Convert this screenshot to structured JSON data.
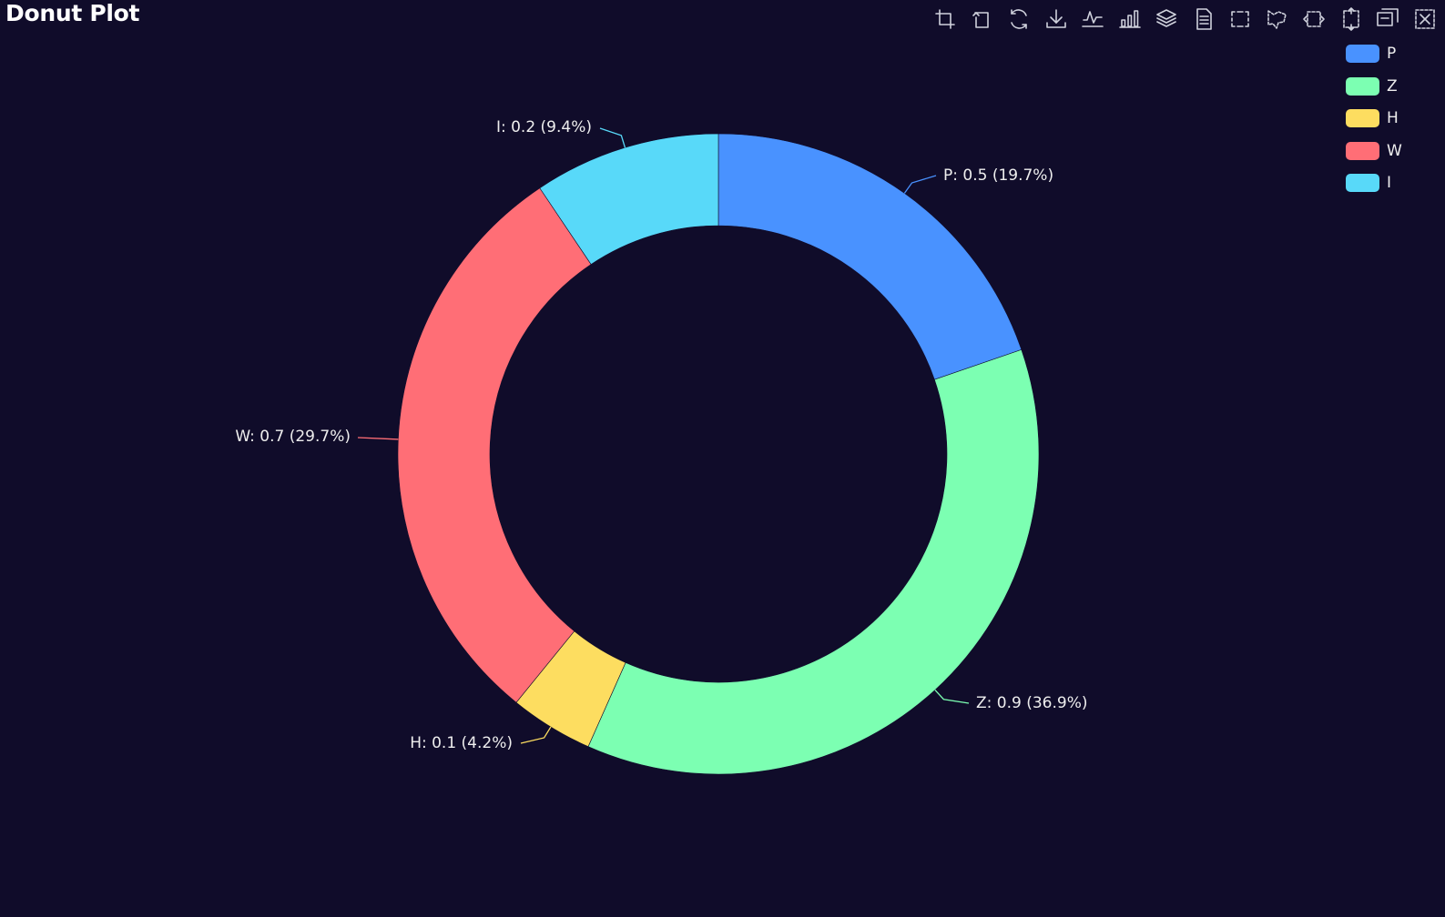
{
  "title": "Donut Plot",
  "colors": {
    "background": "#100c2a",
    "text": "#eeeeee"
  },
  "toolbox": [
    {
      "name": "crop-icon"
    },
    {
      "name": "undo-icon"
    },
    {
      "name": "refresh-icon"
    },
    {
      "name": "download-icon"
    },
    {
      "name": "line-chart-icon"
    },
    {
      "name": "bar-chart-icon"
    },
    {
      "name": "layers-icon"
    },
    {
      "name": "data-view-icon"
    },
    {
      "name": "rect-select-icon"
    },
    {
      "name": "lasso-select-icon"
    },
    {
      "name": "keep-select-icon"
    },
    {
      "name": "clear-select-icon"
    },
    {
      "name": "zoom-select-icon"
    },
    {
      "name": "reset-zoom-icon"
    }
  ],
  "chart_data": {
    "type": "pie",
    "variant": "donut",
    "title": "Donut Plot",
    "legend_position": "top-right",
    "slices": [
      {
        "name": "P",
        "value": 0.5,
        "percent": "19.7%",
        "color": "#4992ff",
        "label": "P: 0.5 (19.7%)"
      },
      {
        "name": "Z",
        "value": 0.9,
        "percent": "36.9%",
        "color": "#7cffb2",
        "label": "Z: 0.9 (36.9%)"
      },
      {
        "name": "H",
        "value": 0.1,
        "percent": "4.2%",
        "color": "#fddd60",
        "label": "H: 0.1 (4.2%)"
      },
      {
        "name": "W",
        "value": 0.7,
        "percent": "29.7%",
        "color": "#ff6e76",
        "label": "W: 0.7 (29.7%)"
      },
      {
        "name": "I",
        "value": 0.2,
        "percent": "9.4%",
        "color": "#58d9f9",
        "label": "I: 0.2 (9.4%)"
      }
    ]
  }
}
